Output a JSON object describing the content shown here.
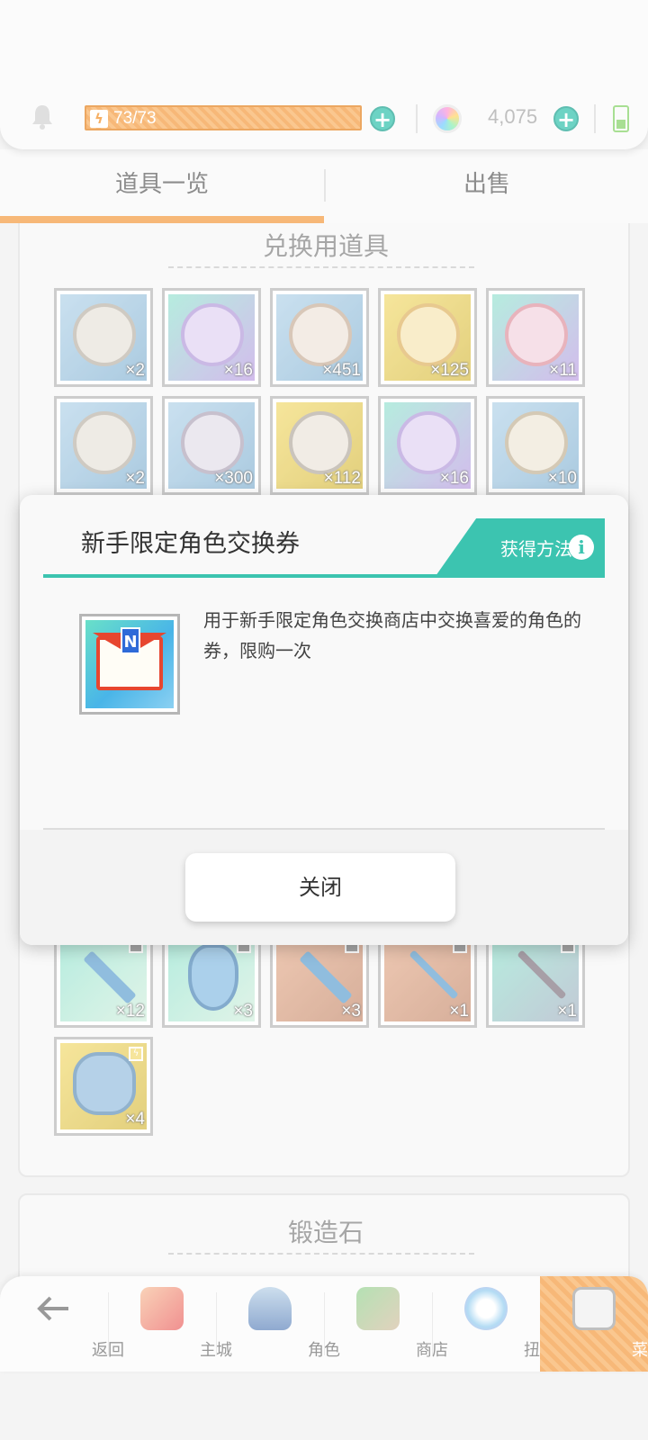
{
  "header": {
    "stamina": "73/73",
    "gems": "4,075"
  },
  "tabs": [
    {
      "label": "道具一览",
      "active": true
    },
    {
      "label": "出售",
      "active": false
    }
  ],
  "section1": {
    "title": "兑换用道具",
    "row1_counts": [
      "×2",
      "×16",
      "×451",
      "×125",
      "×11"
    ],
    "row2_counts": [
      "×2",
      "×300",
      "×112",
      "×16",
      "×10"
    ],
    "row3_counts": [
      "×12",
      "×3",
      "×3",
      "×1",
      "×1"
    ],
    "row4_counts": [
      "×4"
    ]
  },
  "section2": {
    "title": "锻造石"
  },
  "modal": {
    "title": "新手限定角色交换券",
    "howto_label": "获得方法",
    "description": "用于新手限定角色交换商店中交换喜爱的角色的券，限购一次",
    "close_label": "关闭"
  },
  "nav": [
    {
      "label": "返回",
      "icon": "back-arrow-icon"
    },
    {
      "label": "主城",
      "icon": "town-icon"
    },
    {
      "label": "角色",
      "icon": "character-icon"
    },
    {
      "label": "商店",
      "icon": "shop-icon"
    },
    {
      "label": "扭蛋",
      "icon": "gacha-icon"
    },
    {
      "label": "菜单",
      "icon": "menu-icon",
      "active": true
    }
  ],
  "colors": {
    "accent_teal": "#3cc4b0",
    "accent_orange": "#f5a04b"
  }
}
